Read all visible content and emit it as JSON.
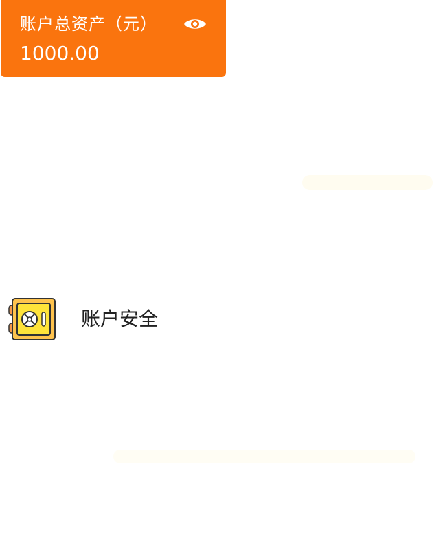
{
  "asset_card": {
    "title": "账户总资产（元）",
    "amount": "1000.00",
    "toggle_icon": "eye-icon",
    "background_color": "#FA740E"
  },
  "menu": {
    "items": [
      {
        "label": "账户安全",
        "icon": "safe-icon"
      }
    ]
  }
}
